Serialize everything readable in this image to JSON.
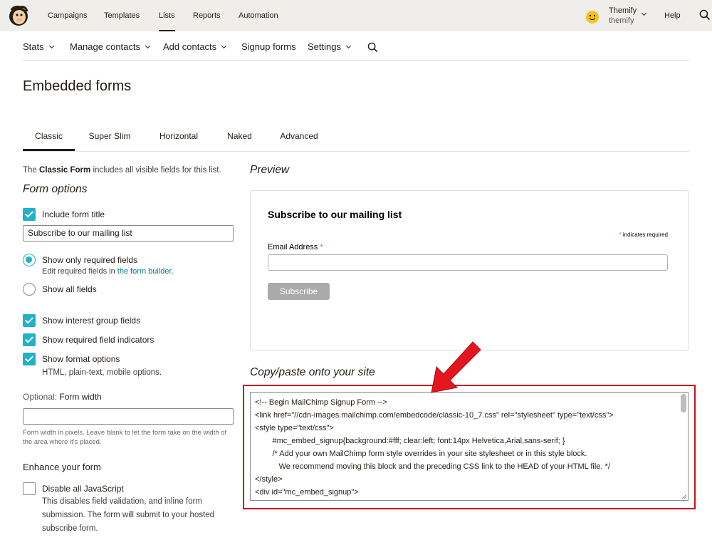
{
  "topnav": {
    "items": [
      "Campaigns",
      "Templates",
      "Lists",
      "Reports",
      "Automation"
    ],
    "active": "Lists",
    "user_name": "Themify",
    "user_account": "themify",
    "help": "Help"
  },
  "subnav": {
    "items": [
      "Stats",
      "Manage contacts",
      "Add contacts",
      "Signup forms",
      "Settings"
    ]
  },
  "page_title": "Embedded forms",
  "tabs": [
    "Classic",
    "Super Slim",
    "Horizontal",
    "Naked",
    "Advanced"
  ],
  "left": {
    "intro_prefix": "The ",
    "intro_bold": "Classic Form",
    "intro_suffix": " includes all visible fields for this list.",
    "form_options_heading": "Form options",
    "include_title_label": "Include form title",
    "title_value": "Subscribe to our mailing list",
    "required_only_label": "Show only required fields",
    "required_sub_prefix": "Edit required fields in ",
    "required_sub_link": "the form builder",
    "required_sub_suffix": ".",
    "all_fields_label": "Show all fields",
    "interest_label": "Show interest group fields",
    "indicators_label": "Show required field indicators",
    "format_label": "Show format options",
    "format_sub": "HTML, plain-text, mobile options.",
    "width_optional": "Optional: ",
    "width_label": "Form width",
    "width_value": "",
    "width_hint": "Form width in pixels. Leave blank to let the form take on the width of the area where it's placed.",
    "enhance_heading": "Enhance your form",
    "disable_js_label": "Disable all JavaScript",
    "disable_js_desc": "This disables field validation, and inline form submission. The form will submit to your hosted subscribe form."
  },
  "preview": {
    "heading": "Preview",
    "title": "Subscribe to our mailing list",
    "required_note": " indicates required",
    "star": "*",
    "email_label": "Email Address ",
    "subscribe_button": "Subscribe"
  },
  "code": {
    "heading": "Copy/paste onto your site",
    "lines": [
      "<!-- Begin MailChimp Signup Form -->",
      "<link href=\"//cdn-images.mailchimp.com/embedcode/classic-10_7.css\" rel=\"stylesheet\" type=\"text/css\">",
      "<style type=\"text/css\">",
      "        #mc_embed_signup{background:#fff; clear:left; font:14px Helvetica,Arial,sans-serif; }",
      "        /* Add your own MailChimp form style overrides in your site stylesheet or in this style block.",
      "           We recommend moving this block and the preceding CSS link to the HEAD of your HTML file. */",
      "</style>",
      "<div id=\"mc_embed_signup\">"
    ]
  },
  "colors": {
    "accent": "#21b1c8",
    "link": "#007c89",
    "highlight": "#c8101e",
    "arrow": "#e3151e"
  }
}
